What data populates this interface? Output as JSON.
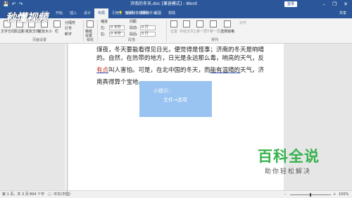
{
  "quick_access": {
    "save": "💾",
    "undo": "↶",
    "redo": "↷"
  },
  "window": {
    "title": "济南的冬天.doc [兼容模式] - Word",
    "login": "登录",
    "min": "–",
    "restore": "❐",
    "close": "✕"
  },
  "tabs": [
    "文件",
    "开始",
    "插入",
    "设计",
    "布局",
    "引用",
    "邮件",
    "审阅",
    "视图",
    "帮助"
  ],
  "active_tab": 4,
  "tellme": "告诉我你想要做什么",
  "share": "共享",
  "ribbon": {
    "page_setup": {
      "text_direction": "文字方向",
      "margins": "页边距",
      "orientation": "纸张方向",
      "size": "纸张大小",
      "columns": "栏",
      "breaks": "分隔符",
      "line_numbers": "行号",
      "hyphenation": "断字",
      "group": "页面设置"
    },
    "draft": {
      "label": "稿纸设置",
      "group": "稿纸"
    },
    "paragraph": {
      "indent": "缩进",
      "spacing": "间距",
      "left_label": "左:",
      "left_value": "0 字符",
      "right_label": "右:",
      "right_value": "0 字符",
      "before_label": "段前:",
      "before_value": "0 行",
      "after_label": "段后:",
      "after_value": "0 行",
      "group": "段落"
    },
    "arrange": {
      "position": "位置",
      "wrap": "环绕文字",
      "forward": "上移一层",
      "backward": "下移一层",
      "pane": "选择窗格",
      "align": "对齐",
      "group": "排列"
    }
  },
  "document": {
    "line1": "煤夜，冬天要能看得见日光，便觉得是怪事；济南的冬天是响晴",
    "line2": "的。自然，在热带的地方，日光是永远那么毒，响亮的天气，反",
    "line3a": "有点",
    "line3b": "叫人害怕。可是，在北中国的冬天，而",
    "line3c": "能有温晴的",
    "line3d": "天气，济",
    "line4": "南真得算个宝地。"
  },
  "tip": {
    "title": "小提示：",
    "body": "文件→选项"
  },
  "watermark": {
    "logo": "秒懂视频",
    "big": "百科全说",
    "small": "助你轻松解决"
  },
  "status": {
    "page": "第 1 页，共 3 页",
    "words": "894 个字",
    "lang": "中文(中国)",
    "zoom_minus": "–",
    "zoom_plus": "+",
    "zoom": "100%"
  }
}
